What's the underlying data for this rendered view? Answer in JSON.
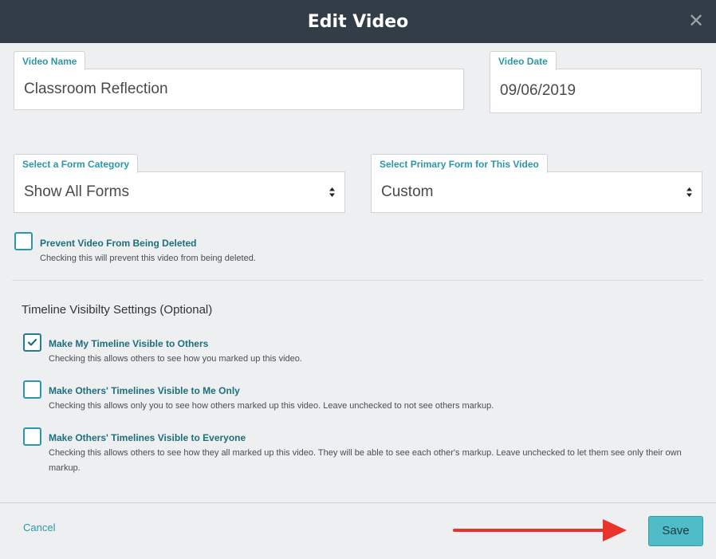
{
  "dialog": {
    "title": "Edit Video",
    "close_icon": "close-icon"
  },
  "fields": {
    "video_name": {
      "label": "Video Name",
      "value": "Classroom Reflection"
    },
    "video_date": {
      "label": "Video Date",
      "value": "09/06/2019"
    },
    "form_category": {
      "label": "Select a Form Category",
      "value": "Show All Forms"
    },
    "primary_form": {
      "label": "Select Primary Form for This Video",
      "value": "Custom"
    }
  },
  "prevent_delete": {
    "label": "Prevent Video From Being Deleted",
    "description": "Checking this will prevent this video from being deleted.",
    "checked": false
  },
  "timeline": {
    "section_title": "Timeline Visibilty Settings (Optional)",
    "options": [
      {
        "label": "Make My Timeline Visible to Others",
        "description": "Checking this allows others to see how you marked up this video.",
        "checked": true
      },
      {
        "label": "Make Others' Timelines Visible to Me Only",
        "description": "Checking this allows only you to see how others marked up this video. Leave unchecked to not see others markup.",
        "checked": false
      },
      {
        "label": "Make Others' Timelines Visible to Everyone",
        "description": "Checking this allows others to see how they all marked up this video. They will be able to see each other's markup. Leave unchecked to let them see only their own markup.",
        "checked": false
      }
    ]
  },
  "footer": {
    "cancel_label": "Cancel",
    "save_label": "Save"
  },
  "colors": {
    "header_bg": "#333d47",
    "accent": "#2a98a8",
    "save_bg": "#4fbcc8",
    "annotation_arrow": "#e8342a"
  }
}
